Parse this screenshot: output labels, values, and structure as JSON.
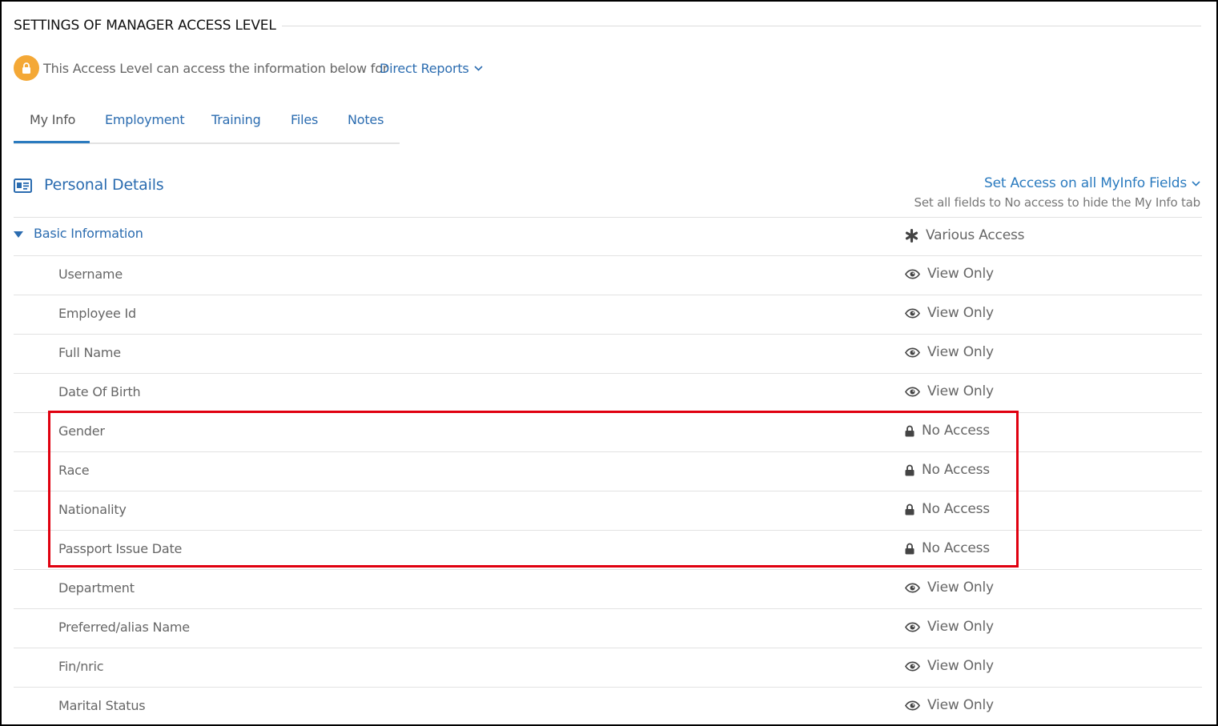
{
  "header": {
    "title": "SETTINGS OF MANAGER ACCESS LEVEL",
    "access_text": "This Access Level can access the information below for",
    "scope_value": "Direct Reports"
  },
  "tabs": [
    {
      "label": "My Info",
      "active": true
    },
    {
      "label": "Employment"
    },
    {
      "label": "Training"
    },
    {
      "label": "Files"
    },
    {
      "label": "Notes"
    }
  ],
  "section": {
    "title": "Personal Details",
    "set_access_label": "Set Access on all MyInfo Fields",
    "set_access_hint": "Set all fields to No access to hide the My Info tab"
  },
  "group": {
    "label": "Basic Information",
    "access": "Various Access",
    "access_icon": "asterisk-icon"
  },
  "fields": [
    {
      "label": "Username",
      "access": "View Only",
      "icon": "eye-icon"
    },
    {
      "label": "Employee Id",
      "access": "View Only",
      "icon": "eye-icon"
    },
    {
      "label": "Full Name",
      "access": "View Only",
      "icon": "eye-icon"
    },
    {
      "label": "Date Of Birth",
      "access": "View Only",
      "icon": "eye-icon"
    },
    {
      "label": "Gender",
      "access": "No Access",
      "icon": "lock-icon"
    },
    {
      "label": "Race",
      "access": "No Access",
      "icon": "lock-icon"
    },
    {
      "label": "Nationality",
      "access": "No Access",
      "icon": "lock-icon"
    },
    {
      "label": "Passport Issue Date",
      "access": "No Access",
      "icon": "lock-icon"
    },
    {
      "label": "Department",
      "access": "View Only",
      "icon": "eye-icon"
    },
    {
      "label": "Preferred/alias Name",
      "access": "View Only",
      "icon": "eye-icon"
    },
    {
      "label": "Fin/nric",
      "access": "View Only",
      "icon": "eye-icon"
    },
    {
      "label": "Marital Status",
      "access": "View Only",
      "icon": "eye-icon"
    }
  ],
  "colors": {
    "accent": "#2b6cb0",
    "badge": "#f4a836",
    "highlight": "#e0000f"
  }
}
